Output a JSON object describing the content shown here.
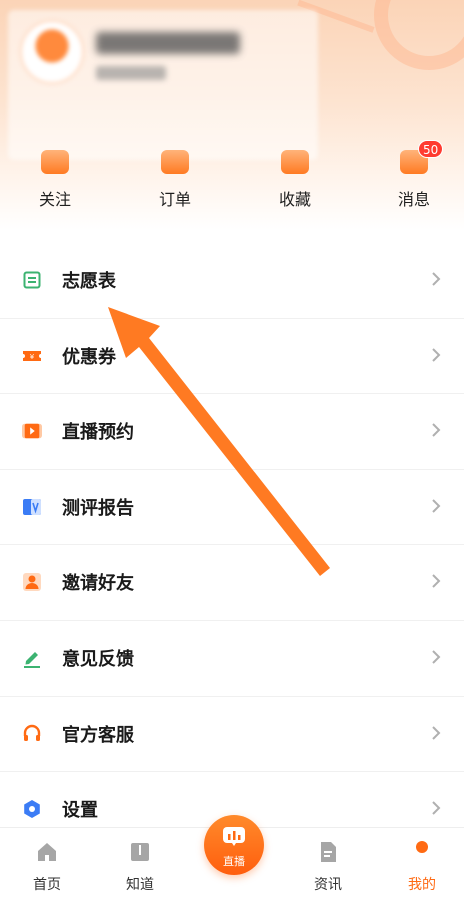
{
  "quick_actions": [
    {
      "label": "关注",
      "icon": "follow-icon"
    },
    {
      "label": "订单",
      "icon": "order-icon"
    },
    {
      "label": "收藏",
      "icon": "favorite-icon"
    },
    {
      "label": "消息",
      "icon": "message-icon",
      "badge": "50"
    }
  ],
  "menu": [
    {
      "label": "志愿表",
      "icon": "application-form-icon",
      "color": "#3cb371"
    },
    {
      "label": "优惠券",
      "icon": "coupon-icon",
      "color": "#ff6a13"
    },
    {
      "label": "直播预约",
      "icon": "live-reservation-icon",
      "color": "#ff6a13"
    },
    {
      "label": "测评报告",
      "icon": "assessment-report-icon",
      "color": "#3b7cf5"
    },
    {
      "label": "邀请好友",
      "icon": "invite-friends-icon",
      "color": "#ff6a13"
    },
    {
      "label": "意见反馈",
      "icon": "feedback-icon",
      "color": "#3cb371"
    },
    {
      "label": "官方客服",
      "icon": "customer-service-icon",
      "color": "#ff6a13"
    },
    {
      "label": "设置",
      "icon": "settings-icon",
      "color": "#3b7cf5"
    }
  ],
  "tabbar": {
    "home": "首页",
    "know": "知道",
    "live": "直播",
    "news": "资讯",
    "mine": "我的"
  },
  "colors": {
    "accent": "#ff6a13",
    "annotation_arrow": "#ff7a22"
  }
}
